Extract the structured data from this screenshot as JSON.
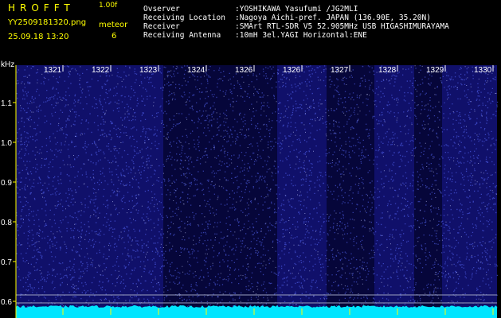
{
  "header": {
    "app_title": "HROFFT",
    "version": "1.00f",
    "filename": "YY2509181320.png",
    "datetime": "25.09.18 13:20",
    "meteor_label": "meteor",
    "meteor_count": "6",
    "info": [
      {
        "key": "Ovserver",
        "value": ":YOSHIKAWA Yasufumi /JG2MLI"
      },
      {
        "key": "Receiving Location",
        "value": ":Nagoya Aichi-pref. JAPAN (136.90E, 35.20N)"
      },
      {
        "key": "Receiver",
        "value": ":SMArt RTL-SDR V5 52.905MHz USB HIGASHIMURAYAMA"
      },
      {
        "key": "Receiving Antenna",
        "value": ":10mH 3el.YAGI Horizontal:ENE"
      }
    ]
  },
  "spectrogram": {
    "y_unit": "kHz",
    "y_ticks": [
      "1.1",
      "1.0",
      "0.9",
      "0.8",
      "0.7",
      "0.6"
    ],
    "x_ticks": [
      "1321",
      "1322",
      "1323",
      "1324",
      "1326",
      "1326",
      "1327",
      "1328",
      "1329",
      "1330"
    ],
    "colors": {
      "background": "#10106a",
      "dark_band": "#06063a",
      "noise": "#5a6cff",
      "axis": "#ffff00",
      "baseline": "#00e5ff"
    }
  }
}
